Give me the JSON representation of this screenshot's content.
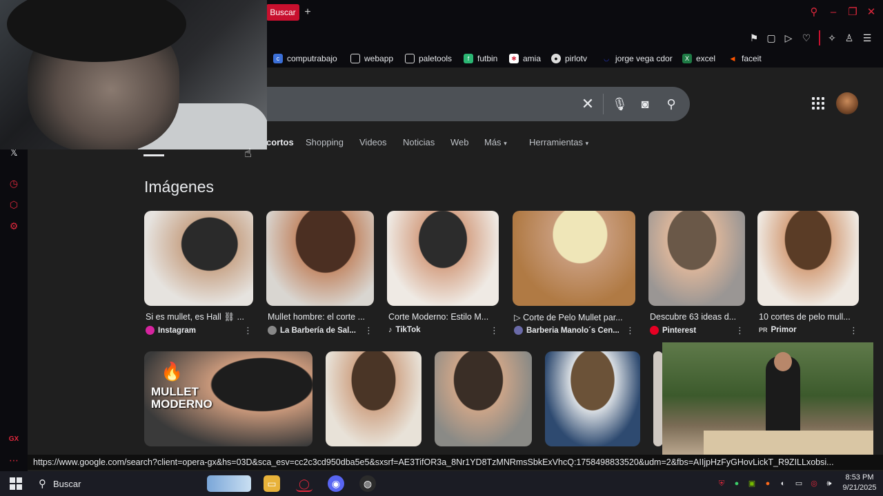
{
  "tabs": {
    "active_label": "Buscar",
    "new_tab": "+"
  },
  "bookmarks": [
    {
      "label": "computrabajo",
      "icon": "briefcase-icon",
      "color": "#3b6fd8"
    },
    {
      "label": "webapp",
      "icon": "page-icon",
      "color": "#444"
    },
    {
      "label": "paletools",
      "icon": "page-icon",
      "color": "#444"
    },
    {
      "label": "futbin",
      "icon": "futbin-icon",
      "color": "#2bb673"
    },
    {
      "label": "amia",
      "icon": "star-icon",
      "color": "#d8344a"
    },
    {
      "label": "pirlotv",
      "icon": "ball-icon",
      "color": "#666"
    },
    {
      "label": "jorge vega cdor",
      "icon": "dot-icon",
      "color": "#2a3bd8"
    },
    {
      "label": "excel",
      "icon": "excel-icon",
      "color": "#1e7b45"
    },
    {
      "label": "faceit",
      "icon": "faceit-icon",
      "color": "#ff5500"
    }
  ],
  "nav_tabs": [
    {
      "label": "cortos"
    },
    {
      "label": "Shopping"
    },
    {
      "label": "Videos"
    },
    {
      "label": "Noticias"
    },
    {
      "label": "Web"
    },
    {
      "label": "Más"
    },
    {
      "label": "Herramientas"
    }
  ],
  "section_title": "Imágenes",
  "images": [
    {
      "title": "Si es mullet, es Hall ⛓ ...",
      "source": "Instagram",
      "src_color": "#d6249f"
    },
    {
      "title": "Mullet hombre: el corte ...",
      "source": "La Barbería de Sal...",
      "src_color": "#888"
    },
    {
      "title": "Corte Moderno: Estilo M...",
      "source": "TikTok",
      "src_color": "#111"
    },
    {
      "title": "▷ Corte de Pelo Mullet par...",
      "source": "Barberia Manolo´s Cen...",
      "src_color": "#6a6aa8"
    },
    {
      "title": "Descubre 63 ideas d...",
      "source": "Pinterest",
      "src_color": "#e60023"
    },
    {
      "title": "10 cortes de pelo mull...",
      "source": "Primor",
      "src_color": "#444"
    }
  ],
  "second_row": {
    "overlay_text": "MULLET MODERNO"
  },
  "status_url": "https://www.google.com/search?client=opera-gx&hs=03D&sca_esv=cc2c3cd950dba5e5&sxsrf=AE3TifOR3a_8Nr1YD8TzMNRmsSbkExVhcQ:1758498833520&udm=2&fbs=AIIjpHzFyGHovLickT_R9ZILLxobsi...",
  "taskbar": {
    "search_label": "Buscar",
    "time": "8:53 PM",
    "date": "9/21/2025"
  },
  "colors": {
    "accent": "#c8102e",
    "page_bg": "#1f1f1f",
    "chrome_bg": "#0b0b0f"
  }
}
